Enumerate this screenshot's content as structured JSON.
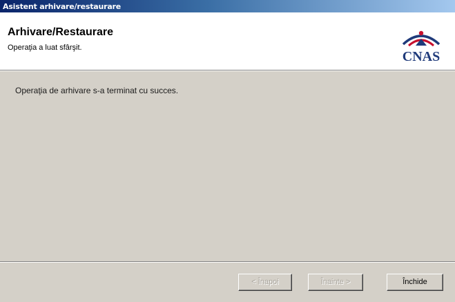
{
  "window": {
    "title": "Asistent arhivare/restaurare"
  },
  "header": {
    "title": "Arhivare/Restaurare",
    "subtitle": "Operaţia a luat sfârşit.",
    "logo_text": "CNAS"
  },
  "main": {
    "message": "Operaţia de arhivare s-a terminat cu succes."
  },
  "buttons": {
    "back_label": "< Înapoi",
    "next_label": "Înainte >",
    "close_label": "Închide",
    "back_enabled": false,
    "next_enabled": false,
    "close_enabled": true
  },
  "colors": {
    "title_bar_start": "#0a246a",
    "title_bar_end": "#a6caf0",
    "dialog_face": "#d4d0c8",
    "header_bg": "#ffffff",
    "logo_red": "#c8102e",
    "logo_blue": "#1f3a7a"
  }
}
